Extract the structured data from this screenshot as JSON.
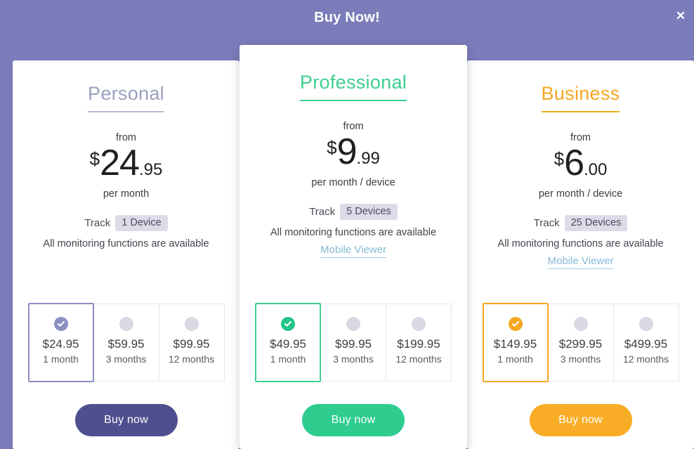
{
  "header": {
    "title": "Buy Now!",
    "close_label": "✕",
    "background_color": "#7b7cba"
  },
  "plans": [
    {
      "id": "personal",
      "name": "Personal",
      "accent_color": "#9ba0c0",
      "underline_color": "#b8bcd3",
      "from_label": "from",
      "price_currency": "$",
      "price_whole": "24",
      "price_cents": ".95",
      "per_label": "per month",
      "track_label": "Track",
      "track_badge": "1 Device",
      "features_line": "All monitoring functions are available",
      "mobile_viewer_label": "",
      "has_mobile_viewer": false,
      "options": [
        {
          "price": "$24.95",
          "term": "1 month",
          "selected": true
        },
        {
          "price": "$59.95",
          "term": "3 months",
          "selected": false
        },
        {
          "price": "$99.95",
          "term": "12 months",
          "selected": false
        }
      ],
      "buy_label": "Buy now",
      "buy_color": "#4f4f8f"
    },
    {
      "id": "professional",
      "name": "Professional",
      "accent_color": "#3ecf8e",
      "underline_color": "#3ecf8e",
      "from_label": "from",
      "price_currency": "$",
      "price_whole": "9",
      "price_cents": ".99",
      "per_label": "per month / device",
      "track_label": "Track",
      "track_badge": "5 Devices",
      "features_line": "All monitoring functions are available",
      "mobile_viewer_label": "Mobile Viewer",
      "has_mobile_viewer": true,
      "options": [
        {
          "price": "$49.95",
          "term": "1 month",
          "selected": true
        },
        {
          "price": "$99.95",
          "term": "3 months",
          "selected": false
        },
        {
          "price": "$199.95",
          "term": "12 months",
          "selected": false
        }
      ],
      "buy_label": "Buy now",
      "buy_color": "#2ecc8f"
    },
    {
      "id": "business",
      "name": "Business",
      "accent_color": "#f5a623",
      "underline_color": "#f5a623",
      "from_label": "from",
      "price_currency": "$",
      "price_whole": "6",
      "price_cents": ".00",
      "per_label": "per month / device",
      "track_label": "Track",
      "track_badge": "25 Devices",
      "features_line": "All monitoring functions are available",
      "mobile_viewer_label": "Mobile Viewer",
      "has_mobile_viewer": true,
      "options": [
        {
          "price": "$149.95",
          "term": "1 month",
          "selected": true
        },
        {
          "price": "$299.95",
          "term": "3 months",
          "selected": false
        },
        {
          "price": "$499.95",
          "term": "12 months",
          "selected": false
        }
      ],
      "buy_label": "Buy now",
      "buy_color": "#f9ad26"
    }
  ]
}
